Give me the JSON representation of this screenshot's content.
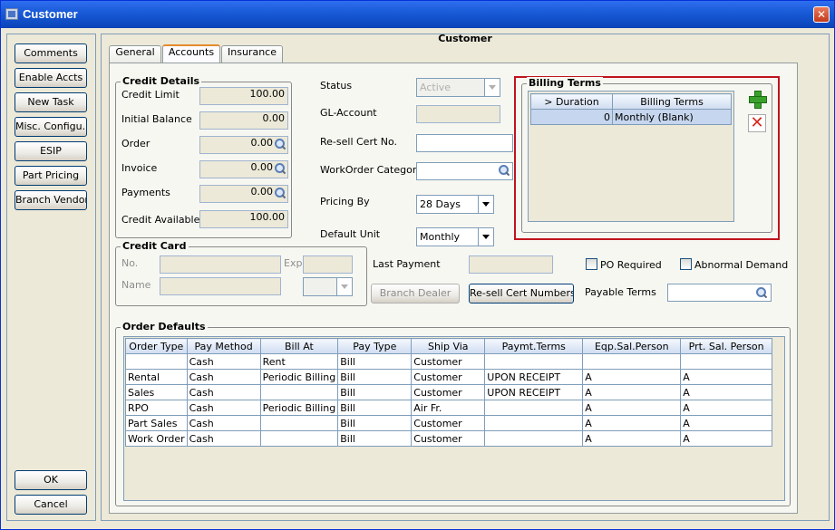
{
  "window": {
    "title": "Customer",
    "close_glyph": "✕",
    "icon": "app-window-icon"
  },
  "sidebar": {
    "buttons": [
      "Comments",
      "Enable Accts",
      "New Task",
      "Misc. Configu...",
      "ESIP",
      "Part Pricing",
      "Branch Vendor"
    ],
    "ok_label": "OK",
    "cancel_label": "Cancel"
  },
  "main": {
    "panel_title": "Customer",
    "tabs": [
      "General",
      "Accounts",
      "Insurance"
    ],
    "active_tab": "Accounts"
  },
  "credit_details": {
    "title": "Credit Details",
    "credit_limit_label": "Credit Limit",
    "credit_limit": "100.00",
    "initial_balance_label": "Initial Balance",
    "initial_balance": "0.00",
    "order_label": "Order",
    "order": "0.00",
    "invoice_label": "Invoice",
    "invoice": "0.00",
    "payments_label": "Payments",
    "payments": "0.00",
    "credit_available_label": "Credit Available",
    "credit_available": "100.00"
  },
  "account": {
    "status_label": "Status",
    "status_value": "Active",
    "gl_account_label": "GL-Account",
    "gl_account_value": "",
    "resell_cert_label": "Re-sell Cert No.",
    "resell_cert_value": "",
    "workorder_category_label": "WorkOrder Category",
    "workorder_category_value": "",
    "pricing_by_label": "Pricing By",
    "pricing_by_value": "28 Days",
    "default_unit_label": "Default Unit",
    "default_unit_value": "Monthly"
  },
  "billing_terms": {
    "title": "Billing Terms",
    "columns": [
      "> Duration",
      "Billing Terms"
    ],
    "rows": [
      [
        "0",
        "Monthly (Blank)"
      ]
    ],
    "add_icon": "add-plus-icon",
    "delete_icon": "delete-x-icon"
  },
  "credit_card": {
    "title": "Credit Card",
    "no_label": "No.",
    "no_value": "",
    "exp_label": "Exp",
    "exp_value": "",
    "name_label": "Name",
    "name_value": ""
  },
  "payment": {
    "last_payment_label": "Last Payment",
    "last_payment_value": "",
    "po_required_label": "PO Required",
    "abnormal_demand_label": "Abnormal Demand",
    "branch_dealer_label": "Branch Dealer",
    "resell_cert_numbers_label": "Re-sell Cert Numbers",
    "payable_terms_label": "Payable Terms",
    "payable_terms_value": ""
  },
  "order_defaults": {
    "title": "Order Defaults",
    "columns": [
      "Order Type",
      "Pay Method",
      "Bill At",
      "Pay Type",
      "Ship Via",
      "Paymt.Terms",
      "Eqp.Sal.Person",
      "Prt. Sal. Person"
    ],
    "rows": [
      [
        "",
        "Cash",
        "Rent",
        "Bill",
        "Customer",
        "",
        "",
        ""
      ],
      [
        "Rental",
        "Cash",
        "Periodic Billing",
        "Bill",
        "Customer",
        "UPON RECEIPT",
        "A",
        "A"
      ],
      [
        "Sales",
        "Cash",
        "",
        "Bill",
        "Customer",
        "UPON RECEIPT",
        "A",
        "A"
      ],
      [
        "RPO",
        "Cash",
        "Periodic Billing",
        "Bill",
        "Air Fr.",
        "",
        "A",
        "A"
      ],
      [
        "Part Sales",
        "Cash",
        "",
        "Bill",
        "Customer",
        "",
        "A",
        "A"
      ],
      [
        "Work Order",
        "Cash",
        "",
        "Bill",
        "Customer",
        "",
        "A",
        "A"
      ]
    ]
  },
  "colors": {
    "titlebar": "#1a5bd8",
    "highlight_border": "#c0141c",
    "selection": "#c6d6ee"
  }
}
